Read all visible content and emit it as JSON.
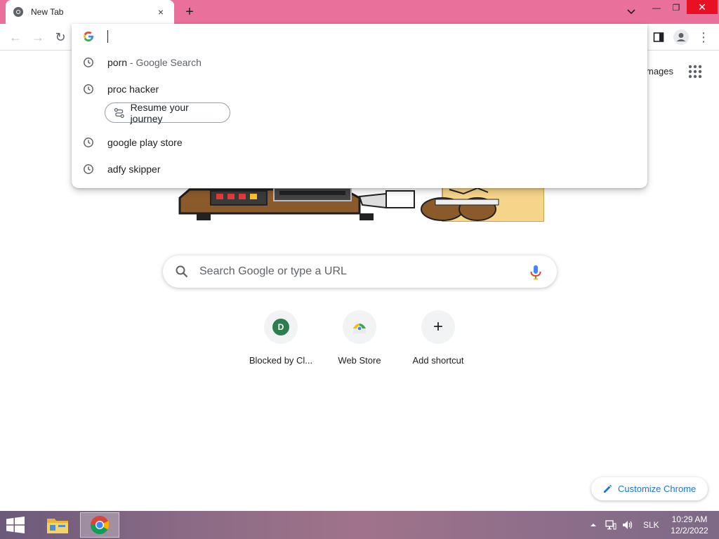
{
  "window": {
    "tab_title": "New Tab",
    "close_tab": "×",
    "new_tab": "+",
    "controls": {
      "minimize": "—",
      "maximize": "❐",
      "close": "✕"
    }
  },
  "toolbar": {
    "back": "←",
    "forward": "→",
    "reload": "↻",
    "menu": "⋮"
  },
  "omnibox": {
    "value": "",
    "suggestions": [
      {
        "text": "porn",
        "sub": " - Google Search",
        "icon": "clock-icon"
      },
      {
        "text": "proc hacker",
        "sub": "",
        "icon": "clock-icon"
      },
      {
        "text": "google play store",
        "sub": "",
        "icon": "clock-icon"
      },
      {
        "text": "adfy skipper",
        "sub": "",
        "icon": "clock-icon"
      }
    ],
    "journey_chip": "Resume your journey"
  },
  "page": {
    "images_link": "mages",
    "search_placeholder": "Search Google or type a URL",
    "shortcuts": [
      {
        "label": "Blocked by Cl...",
        "icon": "D"
      },
      {
        "label": "Web Store",
        "icon": "webstore-icon"
      },
      {
        "label": "Add shortcut",
        "icon": "+"
      }
    ],
    "customize_label": "Customize Chrome"
  },
  "taskbar": {
    "language": "SLK",
    "time": "10:29 AM",
    "date": "12/2/2022"
  },
  "colors": {
    "titlebar": "#e8709a",
    "accent": "#1a73e8",
    "close_button": "#e81123"
  }
}
